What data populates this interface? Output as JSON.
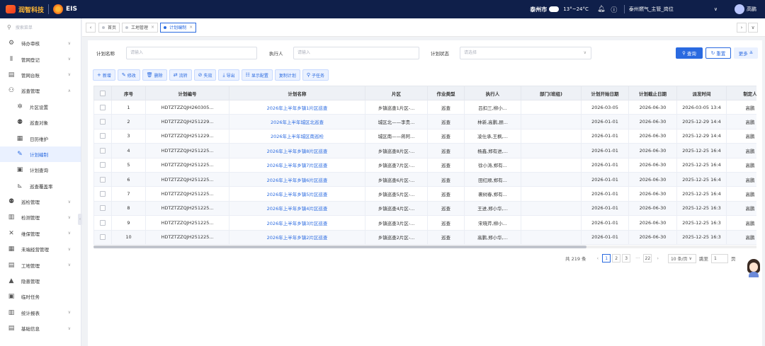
{
  "app": {
    "logo_text": "润智科技",
    "product": "EIS"
  },
  "topbar": {
    "city": "泰州市",
    "temperature": "13°~24°C",
    "role": "泰州燃气_主管_岗位",
    "username": "高鹏"
  },
  "sidebar": {
    "search_placeholder": "搜索菜单",
    "items": [
      {
        "label": "待办审核",
        "icon": "checklist-icon",
        "chev": "∨",
        "level": 0
      },
      {
        "label": "管网登记",
        "icon": "pipe-icon",
        "chev": "∨",
        "level": 0
      },
      {
        "label": "管网台账",
        "icon": "ledger-icon",
        "chev": "∨",
        "level": 0
      },
      {
        "label": "巡查管理",
        "icon": "patrol-icon",
        "chev": "∧",
        "level": 0
      },
      {
        "label": "片区设置",
        "icon": "area-icon",
        "chev": "",
        "level": 1
      },
      {
        "label": "巡查对象",
        "icon": "target-icon",
        "chev": "",
        "level": 1
      },
      {
        "label": "日历维护",
        "icon": "calendar-icon",
        "chev": "",
        "level": 1
      },
      {
        "label": "计划编制",
        "icon": "plan-icon",
        "chev": "",
        "level": 1,
        "active": true
      },
      {
        "label": "计划查询",
        "icon": "query-icon",
        "chev": "",
        "level": 1
      },
      {
        "label": "巡查覆盖率",
        "icon": "coverage-icon",
        "chev": "",
        "level": 1
      },
      {
        "label": "巡检管理",
        "icon": "inspect-icon",
        "chev": "∨",
        "level": 0
      },
      {
        "label": "检测管理",
        "icon": "detect-icon",
        "chev": "∨",
        "level": 0
      },
      {
        "label": "维保管理",
        "icon": "tools-icon",
        "chev": "∨",
        "level": 0
      },
      {
        "label": "未端经营管理",
        "icon": "business-icon",
        "chev": "∨",
        "level": 0
      },
      {
        "label": "工地管理",
        "icon": "site-icon",
        "chev": "∨",
        "level": 0
      },
      {
        "label": "隐患管理",
        "icon": "warning-icon",
        "chev": "",
        "level": 0
      },
      {
        "label": "临时任务",
        "icon": "task-icon",
        "chev": "",
        "level": 0
      },
      {
        "label": "统计报表",
        "icon": "report-icon",
        "chev": "∨",
        "level": 0
      },
      {
        "label": "基础信息",
        "icon": "info-icon",
        "chev": "∨",
        "level": 0
      }
    ]
  },
  "tabs": [
    {
      "label": "首页",
      "active": false
    },
    {
      "label": "工地管理",
      "active": false
    },
    {
      "label": "计划编制",
      "active": true
    }
  ],
  "filters": {
    "plan_name_label": "计划名称",
    "plan_name_placeholder": "请输入",
    "executor_label": "执行人",
    "executor_placeholder": "请输入",
    "status_label": "计划状态",
    "status_placeholder": "请选择",
    "query_label": "查询",
    "reset_label": "重置",
    "more_label": "更多"
  },
  "toolbar": {
    "add": "新增",
    "edit": "修改",
    "delete": "删除",
    "flow": "流转",
    "invalid": "失效",
    "export": "导出",
    "display": "显示配置",
    "copy": "复制计划",
    "subtask": "子任务"
  },
  "table": {
    "headers": [
      "序号",
      "计划编号",
      "计划名称",
      "片区",
      "作业类型",
      "执行人",
      "部门(班组)",
      "计划开始日期",
      "计划截止日期",
      "派发时间",
      "制定人"
    ],
    "rows": [
      [
        "1",
        "HDTZTZZQJH260305...",
        "2026年上半年乡镇1片区巡查",
        "乡镇巡查1片区-...",
        "巡查",
        "吕扣三,柳小...",
        "",
        "2026-03-05",
        "2026-06-30",
        "2026-03-05 13:4",
        "高鹏"
      ],
      [
        "2",
        "HDTZTZZQJH251229...",
        "2026年上半年城区北巡查",
        "城区北——李贵...",
        "巡查",
        "林新,高鹏,顾...",
        "",
        "2026-01-01",
        "2026-06-30",
        "2025-12-29 14:4",
        "高鹏"
      ],
      [
        "3",
        "HDTZTZZQJH251229...",
        "2026年上半年城区南巡检",
        "城区南——蒋阿...",
        "巡查",
        "凌仕承,王枫,...",
        "",
        "2026-01-01",
        "2026-06-30",
        "2025-12-29 14:4",
        "高鹏"
      ],
      [
        "4",
        "HDTZTZZQJH251225...",
        "2026年上半年乡镇8片区巡查",
        "乡镇巡查8片区-...",
        "巡查",
        "杨鑫,郑有进,...",
        "",
        "2026-01-01",
        "2026-06-30",
        "2025-12-25 16:4",
        "高鹏"
      ],
      [
        "5",
        "HDTZTZZQJH251225...",
        "2026年上半年乡镇7片区巡查",
        "乡镇巡查7片区-...",
        "巡查",
        "徐小涛,郑有...",
        "",
        "2026-01-01",
        "2026-06-30",
        "2025-12-25 16:4",
        "高鹏"
      ],
      [
        "6",
        "HDTZTZZQJH251225...",
        "2026年上半年乡镇6片区巡查",
        "乡镇巡查6片区-...",
        "巡查",
        "田红顺,郑有...",
        "",
        "2026-01-01",
        "2026-06-30",
        "2025-12-25 16:4",
        "高鹏"
      ],
      [
        "7",
        "HDTZTZZQJH251225...",
        "2026年上半年乡镇5片区巡查",
        "乡镇巡查5片区-...",
        "巡查",
        "裹树春,郑有...",
        "",
        "2026-01-01",
        "2026-06-30",
        "2025-12-25 16:4",
        "高鹏"
      ],
      [
        "8",
        "HDTZTZZQJH251225...",
        "2026年上半年乡镇4片区巡查",
        "乡镇巡查4片区-...",
        "巡查",
        "王进,郑小华,...",
        "",
        "2026-01-01",
        "2026-06-30",
        "2025-12-25 16:3",
        "高鹏"
      ],
      [
        "9",
        "HDTZTZZQJH251225...",
        "2026年上半年乡镇3片区巡查",
        "乡镇巡查3片区-...",
        "巡查",
        "宋晓芹,柳小...",
        "",
        "2026-01-01",
        "2026-06-30",
        "2025-12-25 16:3",
        "高鹏"
      ],
      [
        "10",
        "HDTZTZZQJH251225...",
        "2026年上半年乡镇2片区巡查",
        "乡镇巡查2片区-...",
        "巡查",
        "高鹏,郑小华,...",
        "",
        "2026-01-01",
        "2026-06-30",
        "2025-12-25 16:3",
        "高鹏"
      ]
    ]
  },
  "pager": {
    "total": "共 219 条",
    "pages": [
      "1",
      "2",
      "3"
    ],
    "last_page": "22",
    "page_size": "10 条/页",
    "jump_label": "跳至",
    "jump_value": "1",
    "page_unit": "页"
  }
}
